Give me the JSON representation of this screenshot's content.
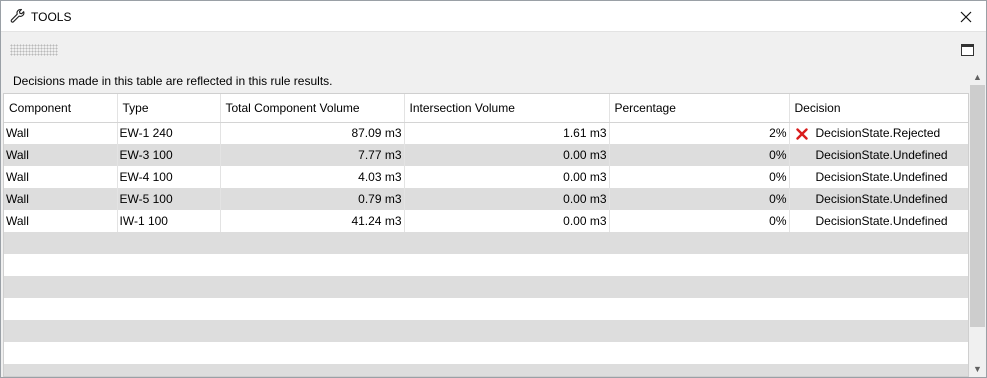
{
  "window": {
    "title": "TOOLS",
    "title_icon": "wrench-icon",
    "close_icon": "close-icon"
  },
  "toolbar": {
    "grip_icon": "grip-dots-icon",
    "maximize_icon": "maximize-icon"
  },
  "info": {
    "message": "Decisions made in this table are reflected in this rule results."
  },
  "table": {
    "columns": [
      "Component",
      "Type",
      "Total Component Volume",
      "Intersection Volume",
      "Percentage",
      "Decision"
    ],
    "rows": [
      {
        "component": "Wall",
        "type": "EW-1 240",
        "total": "87.09 m3",
        "intersection": "1.61 m3",
        "percentage": "2%",
        "decision": "DecisionState.Rejected",
        "decision_icon": "rejected-x-icon"
      },
      {
        "component": "Wall",
        "type": "EW-3 100",
        "total": "7.77 m3",
        "intersection": "0.00 m3",
        "percentage": "0%",
        "decision": "DecisionState.Undefined",
        "decision_icon": ""
      },
      {
        "component": "Wall",
        "type": "EW-4 100",
        "total": "4.03 m3",
        "intersection": "0.00 m3",
        "percentage": "0%",
        "decision": "DecisionState.Undefined",
        "decision_icon": ""
      },
      {
        "component": "Wall",
        "type": "EW-5 100",
        "total": "0.79 m3",
        "intersection": "0.00 m3",
        "percentage": "0%",
        "decision": "DecisionState.Undefined",
        "decision_icon": ""
      },
      {
        "component": "Wall",
        "type": "IW-1 100",
        "total": "41.24 m3",
        "intersection": "0.00 m3",
        "percentage": "0%",
        "decision": "DecisionState.Undefined",
        "decision_icon": ""
      }
    ]
  },
  "colors": {
    "row_alt": "#dddddd",
    "rejected": "#d91c1c"
  }
}
